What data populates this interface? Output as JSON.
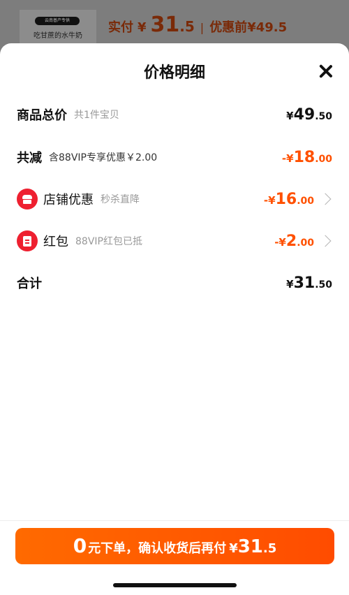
{
  "background": {
    "thumb_badge": "云南普产专供",
    "thumb_text": "吃甘蔗的水牛奶",
    "pay_label": "实付",
    "currency": "¥",
    "pay_int": "31",
    "pay_dec": ".5",
    "orig_label": "优惠前",
    "orig_price": "¥49.5"
  },
  "sheet": {
    "title": "价格明细",
    "rows": {
      "total": {
        "name": "商品总价",
        "sub": "共1件宝贝",
        "yen": "¥",
        "int": "49",
        "dec": ".50"
      },
      "discount": {
        "name": "共减",
        "sub": "含88VIP专享优惠￥2.00",
        "yen": "-¥",
        "int": "18",
        "dec": ".00"
      },
      "store": {
        "name": "店铺优惠",
        "sub": "秒杀直降",
        "yen": "-¥",
        "int": "16",
        "dec": ".00",
        "icon": "store-icon"
      },
      "redpacket": {
        "name": "红包",
        "sub": "88VIP红包已抵",
        "yen": "-¥",
        "int": "2",
        "dec": ".00",
        "icon": "red-packet-icon"
      },
      "sum": {
        "name": "合计",
        "yen": "¥",
        "int": "31",
        "dec": ".50"
      }
    }
  },
  "cta": {
    "big": "0",
    "text": "元下单，确认收货后再付",
    "yen": "¥",
    "int": "31",
    "dec": ".5"
  },
  "colors": {
    "accent": "#ff5000",
    "icon_red": "#ee2030"
  }
}
